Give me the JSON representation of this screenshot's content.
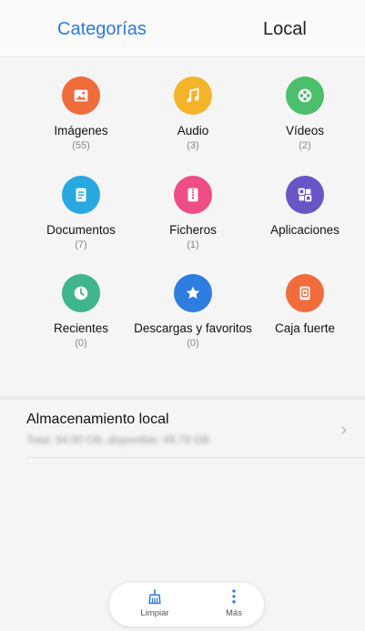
{
  "tabs": [
    {
      "label": "Categorías",
      "active": true
    },
    {
      "label": "Local",
      "active": false
    }
  ],
  "categories": [
    {
      "label": "Imágenes",
      "count": "(55)",
      "icon": "image-icon",
      "color": "#f26b3a"
    },
    {
      "label": "Audio",
      "count": "(3)",
      "icon": "music-note-icon",
      "color": "#f4b42a"
    },
    {
      "label": "Vídeos",
      "count": "(2)",
      "icon": "film-reel-icon",
      "color": "#4bbf6b"
    },
    {
      "label": "Documentos",
      "count": "(7)",
      "icon": "document-icon",
      "color": "#27a9e0"
    },
    {
      "label": "Ficheros",
      "count": "(1)",
      "icon": "archive-icon",
      "color": "#ef4d86"
    },
    {
      "label": "Aplicaciones",
      "count": "",
      "icon": "apps-grid-icon",
      "color": "#6a55c6"
    },
    {
      "label": "Recientes",
      "count": "(0)",
      "icon": "clock-icon",
      "color": "#3fb58c"
    },
    {
      "label": "Descargas y favoritos",
      "count": "(0)",
      "icon": "star-icon",
      "color": "#2e7de0"
    },
    {
      "label": "Caja fuerte",
      "count": "",
      "icon": "safe-icon",
      "color": "#f26b3a"
    }
  ],
  "storage": {
    "title": "Almacenamiento local",
    "subtitle": "Total: 64,00 GB, disponible: 49,79 GB"
  },
  "bottom_bar": {
    "clean_label": "Limpiar",
    "more_label": "Más"
  }
}
